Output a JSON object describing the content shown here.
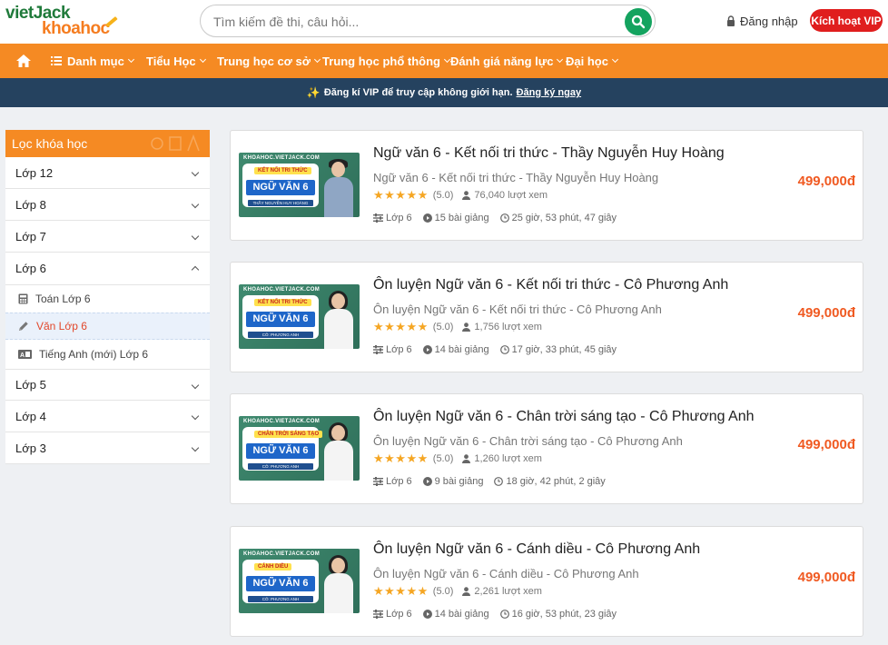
{
  "header": {
    "logo_top": "vietJack",
    "logo_bottom": "khoahoc",
    "search_placeholder": "Tìm kiếm đề thi, câu hỏi...",
    "login_label": "Đăng nhập",
    "vip_button_label": "Kích hoạt VIP"
  },
  "nav": {
    "items": [
      {
        "label": "Danh mục"
      },
      {
        "label": "Tiểu Học"
      },
      {
        "label": "Trung học cơ sở"
      },
      {
        "label": "Trung học phổ thông"
      },
      {
        "label": "Đánh giá năng lực"
      },
      {
        "label": "Đại học"
      }
    ]
  },
  "banner": {
    "prefix": "Đăng kí",
    "vip": "VIP",
    "text": "để truy cập không giới hạn.",
    "link": "Đăng ký ngay"
  },
  "sidebar": {
    "title": "Lọc khóa học",
    "grades": [
      {
        "label": "Lớp 12"
      },
      {
        "label": "Lớp 8"
      },
      {
        "label": "Lớp 7"
      },
      {
        "label": "Lớp 6"
      },
      {
        "label": "Lớp 5"
      },
      {
        "label": "Lớp 4"
      },
      {
        "label": "Lớp 3"
      }
    ],
    "subitems": [
      {
        "label": "Toán Lớp 6"
      },
      {
        "label": "Văn Lớp 6"
      },
      {
        "label": "Tiếng Anh (mới) Lớp 6"
      }
    ]
  },
  "courses": [
    {
      "title": "Ngữ văn 6 - Kết nối tri thức - Thầy Nguyễn Huy Hoàng",
      "subtitle": "Ngữ văn 6 - Kết nối tri thức - Thầy Nguyễn Huy Hoàng",
      "rating": "(5.0)",
      "views": "76,040 lượt xem",
      "grade": "Lớp 6",
      "lessons": "15 bài giảng",
      "duration": "25 giờ, 53 phút, 47 giây",
      "price": "499,000đ",
      "thumb": {
        "site": "KHOAHOC.VIETJACK.COM",
        "tag": "KẾT NỐI TRI THỨC",
        "subject": "NGỮ VĂN 6",
        "teacher": "THẦY NGUYỄN HUY HOÀNG"
      }
    },
    {
      "title": "Ôn luyện Ngữ văn 6 - Kết nối tri thức - Cô Phương Anh",
      "subtitle": "Ôn luyện Ngữ văn 6 - Kết nối tri thức - Cô Phương Anh",
      "rating": "(5.0)",
      "views": "1,756 lượt xem",
      "grade": "Lớp 6",
      "lessons": "14 bài giảng",
      "duration": "17 giờ, 33 phút, 45 giây",
      "price": "499,000đ",
      "thumb": {
        "site": "KHOAHOC.VIETJACK.COM",
        "tag": "KẾT NỐI TRI THỨC",
        "subject": "NGỮ VĂN 6",
        "teacher": "CÔ: PHƯƠNG ANH"
      }
    },
    {
      "title": "Ôn luyện Ngữ văn 6 - Chân trời sáng tạo - Cô Phương Anh",
      "subtitle": "Ôn luyện Ngữ văn 6 - Chân trời sáng tạo - Cô Phương Anh",
      "rating": "(5.0)",
      "views": "1,260 lượt xem",
      "grade": "Lớp 6",
      "lessons": "9 bài giảng",
      "duration": "18 giờ, 42 phút, 2 giây",
      "price": "499,000đ",
      "thumb": {
        "site": "KHOAHOC.VIETJACK.COM",
        "tag": "CHÂN TRỜI SÁNG TẠO",
        "subject": "NGỮ VĂN 6",
        "teacher": "CÔ: PHƯƠNG ANH"
      }
    },
    {
      "title": "Ôn luyện Ngữ văn 6 - Cánh diều - Cô Phương Anh",
      "subtitle": "Ôn luyện Ngữ văn 6 - Cánh diều - Cô Phương Anh",
      "rating": "(5.0)",
      "views": "2,261 lượt xem",
      "grade": "Lớp 6",
      "lessons": "14 bài giảng",
      "duration": "16 giờ, 53 phút, 23 giây",
      "price": "499,000đ",
      "thumb": {
        "site": "KHOAHOC.VIETJACK.COM",
        "tag": "CÁNH DIỀU",
        "subject": "NGỮ VĂN 6",
        "teacher": "CÔ: PHƯƠNG ANH"
      }
    }
  ],
  "colors": {
    "brand_orange": "#f58a23",
    "banner_navy": "#25425f",
    "price_red": "#f05a22",
    "vip_red": "#e01e1e",
    "search_green": "#14a35f"
  }
}
